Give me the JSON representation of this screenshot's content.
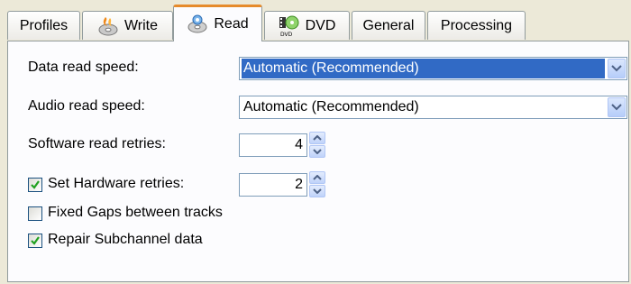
{
  "tabs": [
    {
      "label": "Profiles",
      "icon": "none"
    },
    {
      "label": "Write",
      "icon": "burn-disc-icon"
    },
    {
      "label": "Read",
      "icon": "read-disc-icon",
      "active": true
    },
    {
      "label": "DVD",
      "icon": "dvd-icon"
    },
    {
      "label": "General",
      "icon": "none"
    },
    {
      "label": "Processing",
      "icon": "none"
    }
  ],
  "read": {
    "data_speed": {
      "label": "Data read speed:",
      "value": "Automatic (Recommended)"
    },
    "audio_speed": {
      "label": "Audio read speed:",
      "value": "Automatic (Recommended)"
    },
    "software_retries": {
      "label": "Software read retries:",
      "value": "4"
    },
    "hardware_retries": {
      "label": "Set Hardware retries:",
      "value": "2",
      "checked": true
    },
    "fixed_gaps": {
      "label": "Fixed Gaps between tracks",
      "checked": false
    },
    "repair_subchannel": {
      "label": "Repair Subchannel data",
      "checked": true
    }
  },
  "colors": {
    "window_bg": "#ece9d8",
    "panel_bg": "#fcfcfe",
    "selection": "#316ac5",
    "active_tab_accent": "#e68b2c",
    "check_green": "#21a121"
  }
}
